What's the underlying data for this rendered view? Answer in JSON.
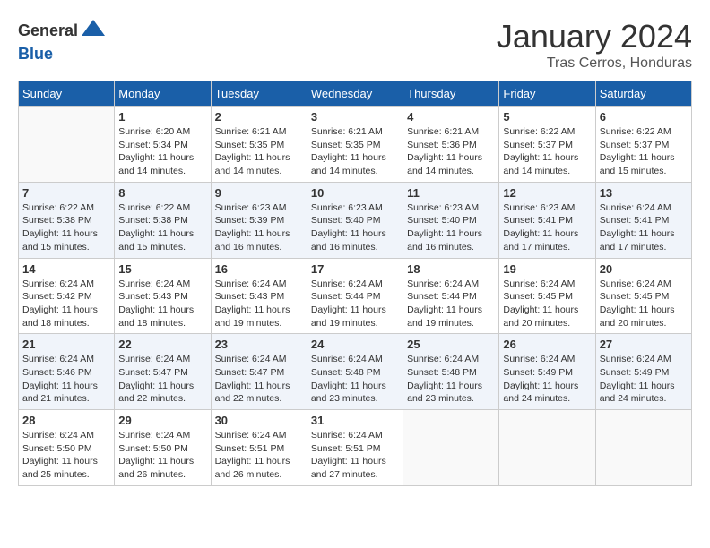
{
  "header": {
    "logo_line1": "General",
    "logo_line2": "Blue",
    "month": "January 2024",
    "location": "Tras Cerros, Honduras"
  },
  "days_of_week": [
    "Sunday",
    "Monday",
    "Tuesday",
    "Wednesday",
    "Thursday",
    "Friday",
    "Saturday"
  ],
  "weeks": [
    [
      {
        "day": "",
        "detail": ""
      },
      {
        "day": "1",
        "detail": "Sunrise: 6:20 AM\nSunset: 5:34 PM\nDaylight: 11 hours\nand 14 minutes."
      },
      {
        "day": "2",
        "detail": "Sunrise: 6:21 AM\nSunset: 5:35 PM\nDaylight: 11 hours\nand 14 minutes."
      },
      {
        "day": "3",
        "detail": "Sunrise: 6:21 AM\nSunset: 5:35 PM\nDaylight: 11 hours\nand 14 minutes."
      },
      {
        "day": "4",
        "detail": "Sunrise: 6:21 AM\nSunset: 5:36 PM\nDaylight: 11 hours\nand 14 minutes."
      },
      {
        "day": "5",
        "detail": "Sunrise: 6:22 AM\nSunset: 5:37 PM\nDaylight: 11 hours\nand 14 minutes."
      },
      {
        "day": "6",
        "detail": "Sunrise: 6:22 AM\nSunset: 5:37 PM\nDaylight: 11 hours\nand 15 minutes."
      }
    ],
    [
      {
        "day": "7",
        "detail": "Sunrise: 6:22 AM\nSunset: 5:38 PM\nDaylight: 11 hours\nand 15 minutes."
      },
      {
        "day": "8",
        "detail": "Sunrise: 6:22 AM\nSunset: 5:38 PM\nDaylight: 11 hours\nand 15 minutes."
      },
      {
        "day": "9",
        "detail": "Sunrise: 6:23 AM\nSunset: 5:39 PM\nDaylight: 11 hours\nand 16 minutes."
      },
      {
        "day": "10",
        "detail": "Sunrise: 6:23 AM\nSunset: 5:40 PM\nDaylight: 11 hours\nand 16 minutes."
      },
      {
        "day": "11",
        "detail": "Sunrise: 6:23 AM\nSunset: 5:40 PM\nDaylight: 11 hours\nand 16 minutes."
      },
      {
        "day": "12",
        "detail": "Sunrise: 6:23 AM\nSunset: 5:41 PM\nDaylight: 11 hours\nand 17 minutes."
      },
      {
        "day": "13",
        "detail": "Sunrise: 6:24 AM\nSunset: 5:41 PM\nDaylight: 11 hours\nand 17 minutes."
      }
    ],
    [
      {
        "day": "14",
        "detail": "Sunrise: 6:24 AM\nSunset: 5:42 PM\nDaylight: 11 hours\nand 18 minutes."
      },
      {
        "day": "15",
        "detail": "Sunrise: 6:24 AM\nSunset: 5:43 PM\nDaylight: 11 hours\nand 18 minutes."
      },
      {
        "day": "16",
        "detail": "Sunrise: 6:24 AM\nSunset: 5:43 PM\nDaylight: 11 hours\nand 19 minutes."
      },
      {
        "day": "17",
        "detail": "Sunrise: 6:24 AM\nSunset: 5:44 PM\nDaylight: 11 hours\nand 19 minutes."
      },
      {
        "day": "18",
        "detail": "Sunrise: 6:24 AM\nSunset: 5:44 PM\nDaylight: 11 hours\nand 19 minutes."
      },
      {
        "day": "19",
        "detail": "Sunrise: 6:24 AM\nSunset: 5:45 PM\nDaylight: 11 hours\nand 20 minutes."
      },
      {
        "day": "20",
        "detail": "Sunrise: 6:24 AM\nSunset: 5:45 PM\nDaylight: 11 hours\nand 20 minutes."
      }
    ],
    [
      {
        "day": "21",
        "detail": "Sunrise: 6:24 AM\nSunset: 5:46 PM\nDaylight: 11 hours\nand 21 minutes."
      },
      {
        "day": "22",
        "detail": "Sunrise: 6:24 AM\nSunset: 5:47 PM\nDaylight: 11 hours\nand 22 minutes."
      },
      {
        "day": "23",
        "detail": "Sunrise: 6:24 AM\nSunset: 5:47 PM\nDaylight: 11 hours\nand 22 minutes."
      },
      {
        "day": "24",
        "detail": "Sunrise: 6:24 AM\nSunset: 5:48 PM\nDaylight: 11 hours\nand 23 minutes."
      },
      {
        "day": "25",
        "detail": "Sunrise: 6:24 AM\nSunset: 5:48 PM\nDaylight: 11 hours\nand 23 minutes."
      },
      {
        "day": "26",
        "detail": "Sunrise: 6:24 AM\nSunset: 5:49 PM\nDaylight: 11 hours\nand 24 minutes."
      },
      {
        "day": "27",
        "detail": "Sunrise: 6:24 AM\nSunset: 5:49 PM\nDaylight: 11 hours\nand 24 minutes."
      }
    ],
    [
      {
        "day": "28",
        "detail": "Sunrise: 6:24 AM\nSunset: 5:50 PM\nDaylight: 11 hours\nand 25 minutes."
      },
      {
        "day": "29",
        "detail": "Sunrise: 6:24 AM\nSunset: 5:50 PM\nDaylight: 11 hours\nand 26 minutes."
      },
      {
        "day": "30",
        "detail": "Sunrise: 6:24 AM\nSunset: 5:51 PM\nDaylight: 11 hours\nand 26 minutes."
      },
      {
        "day": "31",
        "detail": "Sunrise: 6:24 AM\nSunset: 5:51 PM\nDaylight: 11 hours\nand 27 minutes."
      },
      {
        "day": "",
        "detail": ""
      },
      {
        "day": "",
        "detail": ""
      },
      {
        "day": "",
        "detail": ""
      }
    ]
  ]
}
